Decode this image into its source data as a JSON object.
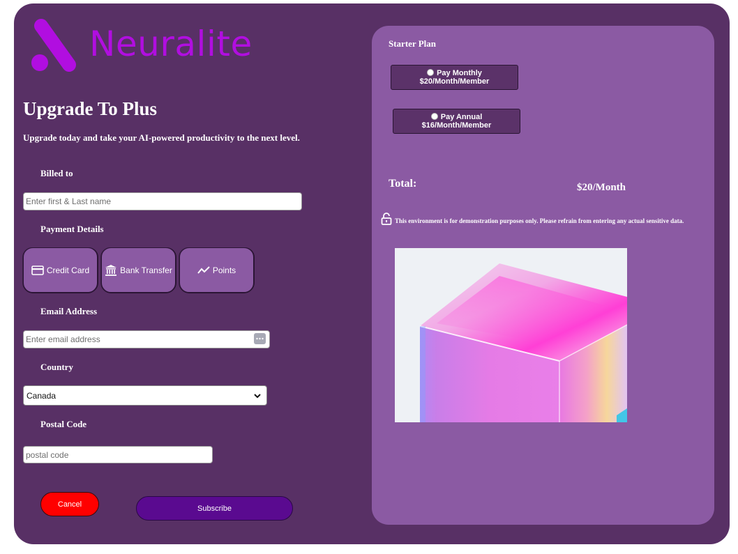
{
  "brand": {
    "name": "Neuralite",
    "color": "#b10ee0"
  },
  "header": {
    "title": "Upgrade To Plus",
    "subtitle": "Upgrade today and take your AI-powered productivity to the next level."
  },
  "form": {
    "billed_to_label": "Billed to",
    "name_placeholder": "Enter first & Last name",
    "payment_details_label": "Payment Details",
    "payment_methods": [
      {
        "label": "Credit Card",
        "icon": "credit-card-icon"
      },
      {
        "label": "Bank Transfer",
        "icon": "bank-icon"
      },
      {
        "label": "Points",
        "icon": "trend-icon"
      }
    ],
    "email_label": "Email Address",
    "email_placeholder": "Enter email address",
    "country_label": "Country",
    "country_value": "Canada",
    "postal_label": "Postal Code",
    "postal_placeholder": "postal code",
    "cancel_label": "Cancel",
    "subscribe_label": "Subscribe"
  },
  "plan": {
    "title": "Starter Plan",
    "options": [
      {
        "name": "Pay Monthly",
        "price": "$20/Month/Member"
      },
      {
        "name": "Pay Annual",
        "price": "$16/Month/Member"
      }
    ],
    "total_label": "Total:",
    "total_value": "$20/Month",
    "notice": "This environment is for demonstration purposes only. Please refrain from entering any actual sensitive data."
  },
  "colors": {
    "background": "#583065",
    "panel": "#8b5aa3",
    "cancel": "#ff0000",
    "subscribe": "#5a0a90"
  }
}
